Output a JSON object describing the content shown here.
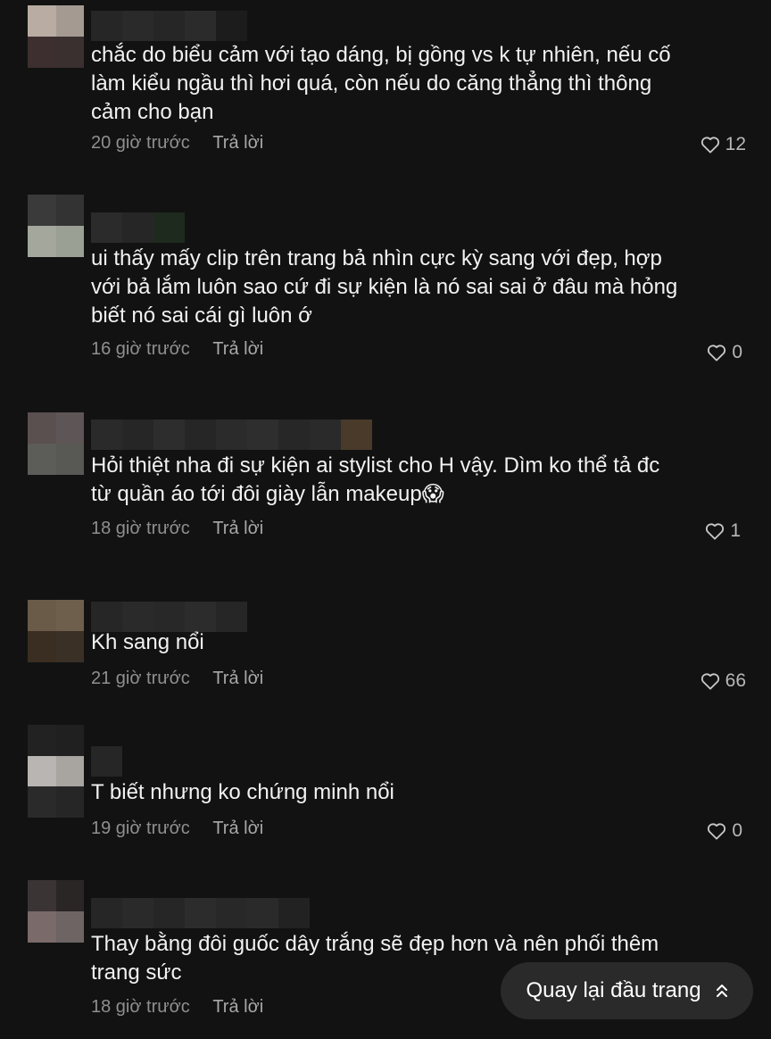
{
  "comments": [
    {
      "text": "chắc do biểu cảm với tạo dáng, bị gồng vs k tự nhiên, nếu cố làm kiểu ngầu thì hơi quá, còn nếu do căng thẳng thì thông cảm cho bạn",
      "time": "20 giờ trước",
      "reply": "Trả lời",
      "likes": "12"
    },
    {
      "text": "ui thấy mấy clip trên trang bả nhìn cực kỳ sang với đẹp, hợp với bả lắm luôn sao cứ đi sự kiện là nó sai sai ở đâu mà hỏng biết nó sai cái gì luôn ớ",
      "time": "16 giờ trước",
      "reply": "Trả lời",
      "likes": "0"
    },
    {
      "text": "Hỏi thiệt nha đi sự kiện ai stylist cho H vậy. Dìm ko thể tả đc từ quần áo tới đôi giày lẫn makeup😱",
      "time": "18 giờ trước",
      "reply": "Trả lời",
      "likes": "1"
    },
    {
      "text": "Kh sang nổi",
      "time": "21 giờ trước",
      "reply": "Trả lời",
      "likes": "66"
    },
    {
      "text": "T biết nhưng ko chứng minh nổi",
      "time": "19 giờ trước",
      "reply": "Trả lời",
      "likes": "0"
    },
    {
      "text": "Thay bằng đôi guốc dây trắng sẽ đẹp hơn và nên phối thêm trang sức",
      "time": "18 giờ trước",
      "reply": "Trả lời",
      "likes": ""
    }
  ],
  "back_to_top": {
    "label": "Quay lại đầu trang",
    "icon": "double-chevron-up-icon"
  },
  "icons": {
    "like": "heart-outline-icon"
  },
  "colors": {
    "background": "#121212",
    "text": "#f2f2f2",
    "meta": "#8f8f8f",
    "pill": "#2a2a2a"
  }
}
